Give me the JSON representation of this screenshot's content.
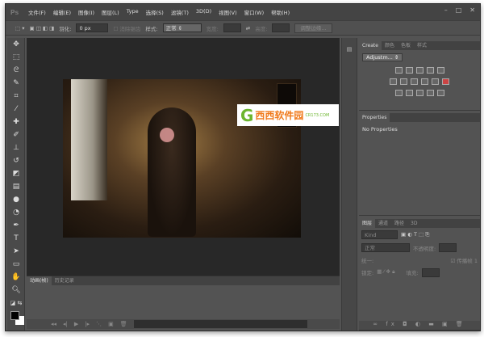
{
  "app": {
    "logo": "Ps",
    "window_controls": [
      "–",
      "□",
      "✕"
    ]
  },
  "menu": [
    "文件(F)",
    "编辑(E)",
    "图像(I)",
    "图层(L)",
    "Type",
    "选择(S)",
    "滤镜(T)",
    "3D(D)",
    "视图(V)",
    "窗口(W)",
    "帮助(H)"
  ],
  "options": {
    "feather_label": "羽化:",
    "feather_value": "0 px",
    "antialias_label": "消除锯齿",
    "style_label": "样式:",
    "style_value": "正常",
    "width_label": "宽度:",
    "height_label": "高度:",
    "refine_edge": "调整边缘..."
  },
  "watermark": {
    "text": "西西软件园",
    "sub": "CR173.COM"
  },
  "adjustments": {
    "tabs": [
      "Create",
      "颜色",
      "色板",
      "样式"
    ],
    "dropdown": "Adjustm..."
  },
  "properties": {
    "tab": "Properties",
    "text": "No Properties"
  },
  "layers": {
    "tabs": [
      "图层",
      "通道",
      "路径",
      "3D"
    ],
    "kind": "Kind",
    "blend": "正常",
    "opacity_label": "不透明度:",
    "unify_label": "统一:",
    "propagate_label": "传播帧 1",
    "lock_label": "锁定:",
    "fill_label": "填充:"
  },
  "timeline": {
    "tabs": [
      "动画(帧)",
      "历史记录"
    ]
  }
}
